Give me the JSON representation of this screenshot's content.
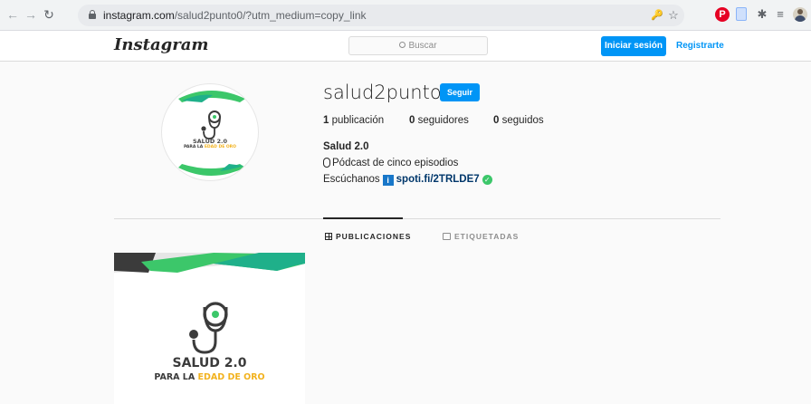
{
  "browser": {
    "url_host": "instagram.com",
    "url_path": "/salud2punto0/?utm_medium=copy_link",
    "back_icon": "arrow-left-icon",
    "forward_icon": "arrow-right-icon",
    "reload_icon": "reload-icon",
    "pinterest_glyph": "P"
  },
  "header": {
    "logo": "Instagram",
    "search_placeholder": "Buscar",
    "login_label": "Iniciar sesión",
    "register_label": "Registrarte"
  },
  "profile": {
    "username": "salud2punto0",
    "follow_label": "Seguir",
    "stats": {
      "posts_count": "1",
      "posts_label": "publicación",
      "followers_count": "0",
      "followers_label": "seguidores",
      "following_count": "0",
      "following_label": "seguidos"
    },
    "bio_name": "Salud 2.0",
    "bio_line1": "Pódcast de cinco episodios",
    "bio_listen": "Escúchanos",
    "bio_info_glyph": "i",
    "bio_link": "spoti.fi/2TRLDE7",
    "avatar_logo_line1": "SALUD 2.0",
    "avatar_logo_line2_dark": "PARA LA ",
    "avatar_logo_line2_gold": "EDAD DE ORO"
  },
  "tabs": [
    {
      "label": "PUBLICACIONES",
      "active": true
    },
    {
      "label": "ETIQUETADAS",
      "active": false
    }
  ],
  "post": {
    "logo_line1": "SALUD 2.0",
    "logo_line2_dark": "PARA LA ",
    "logo_line2_gold": "EDAD DE ORO"
  },
  "colors": {
    "accent": "#0095f6",
    "green": "#3cc76a",
    "teal": "#1fb08a",
    "gold": "#f2b21e",
    "dark_logo": "#3b3b3b"
  }
}
